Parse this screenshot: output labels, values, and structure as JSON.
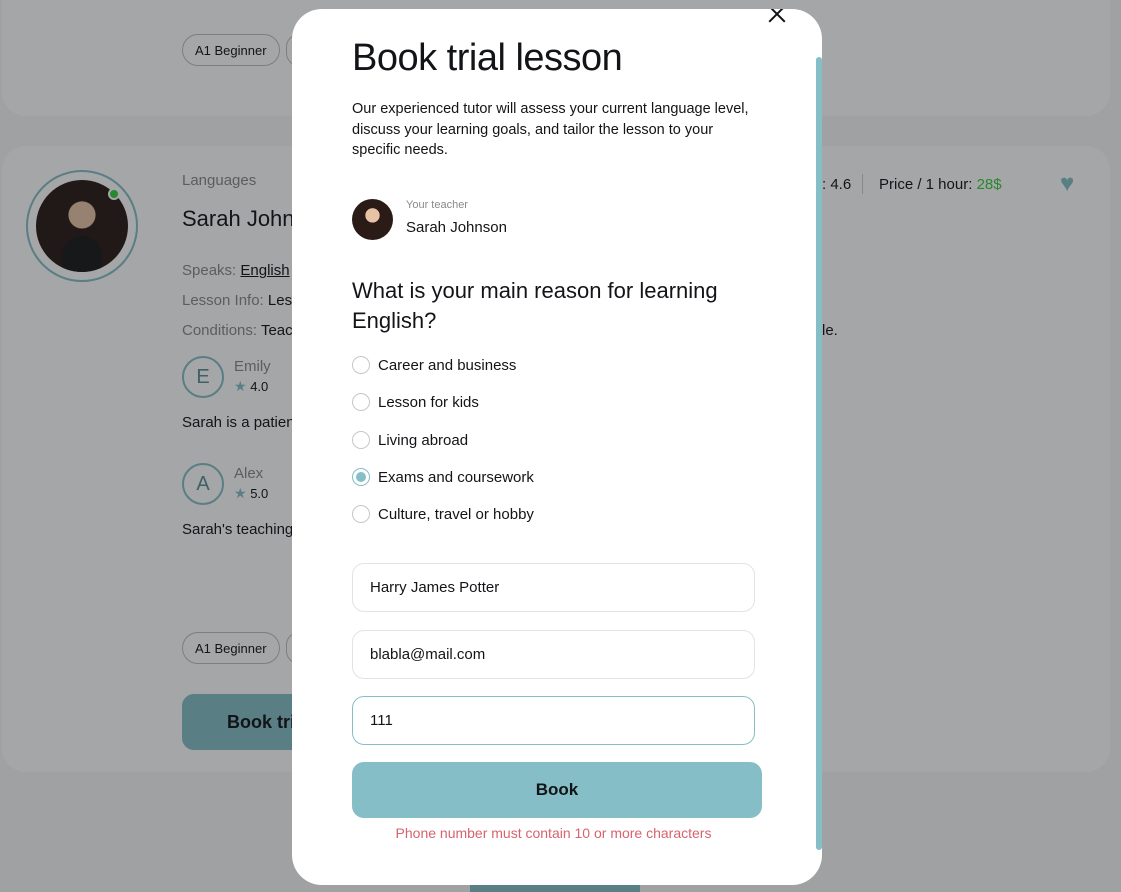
{
  "background": {
    "top_card": {
      "level_tag": "A1 Beginner"
    },
    "card": {
      "category": "Languages",
      "teacher_name": "Sarah John",
      "speaks_label": "Speaks:",
      "speaks_value": "English",
      "lesson_info_label": "Lesson Info:",
      "lesson_info_value": "Les",
      "conditions_label": "Conditions:",
      "conditions_value": "Teac",
      "conditions_tail": "le.",
      "rating_fragment": ": 4.6",
      "price_label": "Price / 1 hour:",
      "price_value": "28$",
      "reviews": [
        {
          "initial": "E",
          "name": "Emily",
          "rating": "4.0",
          "text": "Sarah is a patien"
        },
        {
          "initial": "A",
          "name": "Alex",
          "rating": "5.0",
          "text": "Sarah's teaching"
        }
      ],
      "level_tag": "A1 Beginner",
      "book_button": "Book tria"
    }
  },
  "modal": {
    "title": "Book trial lesson",
    "description": "Our experienced tutor will assess your current language level, discuss your learning goals, and tailor the lesson to your specific needs.",
    "teacher_label": "Your teacher",
    "teacher_name": "Sarah Johnson",
    "question": "What is your main reason for learning English?",
    "reasons": [
      {
        "label": "Career and business",
        "checked": false
      },
      {
        "label": "Lesson for kids",
        "checked": false
      },
      {
        "label": "Living abroad",
        "checked": false
      },
      {
        "label": "Exams and coursework",
        "checked": true
      },
      {
        "label": "Culture, travel or hobby",
        "checked": false
      }
    ],
    "fields": {
      "name": "Harry James Potter",
      "email": "blabla@mail.com",
      "phone": "111"
    },
    "book_button": "Book",
    "error": "Phone number must contain 10 or more characters"
  },
  "colors": {
    "accent": "#85bec7",
    "error": "#d6636e",
    "price_green": "#38cd3e",
    "text": "#121417"
  }
}
